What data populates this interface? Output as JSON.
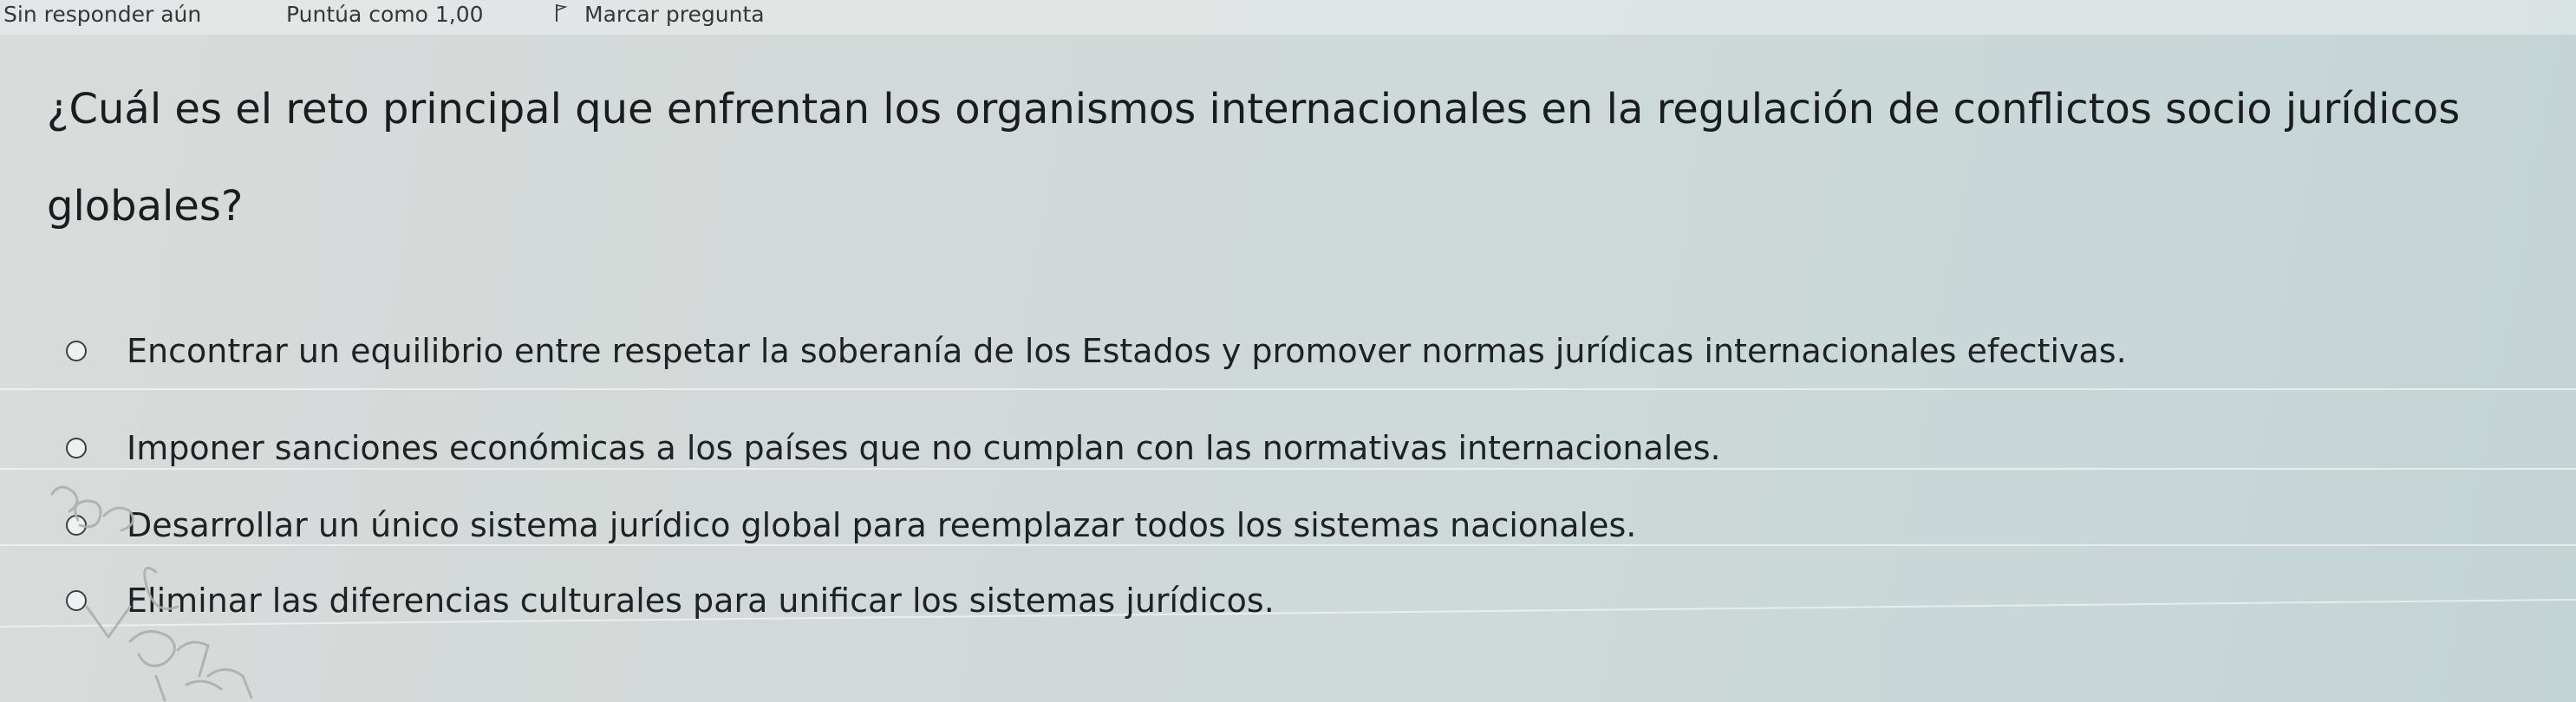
{
  "header": {
    "status": "Sin responder aún",
    "grade": "Puntúa como 1,00",
    "flag_label": "Marcar pregunta"
  },
  "question": {
    "text": "¿Cuál es el reto principal que enfrentan los organismos internacionales en la regulación de conflictos socio jurídicos globales?"
  },
  "options": [
    {
      "label": "Encontrar un equilibrio entre respetar la soberanía de los Estados y promover normas jurídicas internacionales efectivas."
    },
    {
      "label": "Imponer sanciones económicas a los países que no cumplan con las normativas internacionales."
    },
    {
      "label": "Desarrollar un único sistema jurídico global para reemplazar todos los sistemas nacionales."
    },
    {
      "label": "Eliminar las diferencias culturales para unificar los sistemas jurídicos."
    }
  ],
  "icons": {
    "flag": "flag-icon",
    "radio": "radio-icon"
  },
  "colors": {
    "text": "#1c1f21",
    "annotation": "#a7b3ae"
  }
}
